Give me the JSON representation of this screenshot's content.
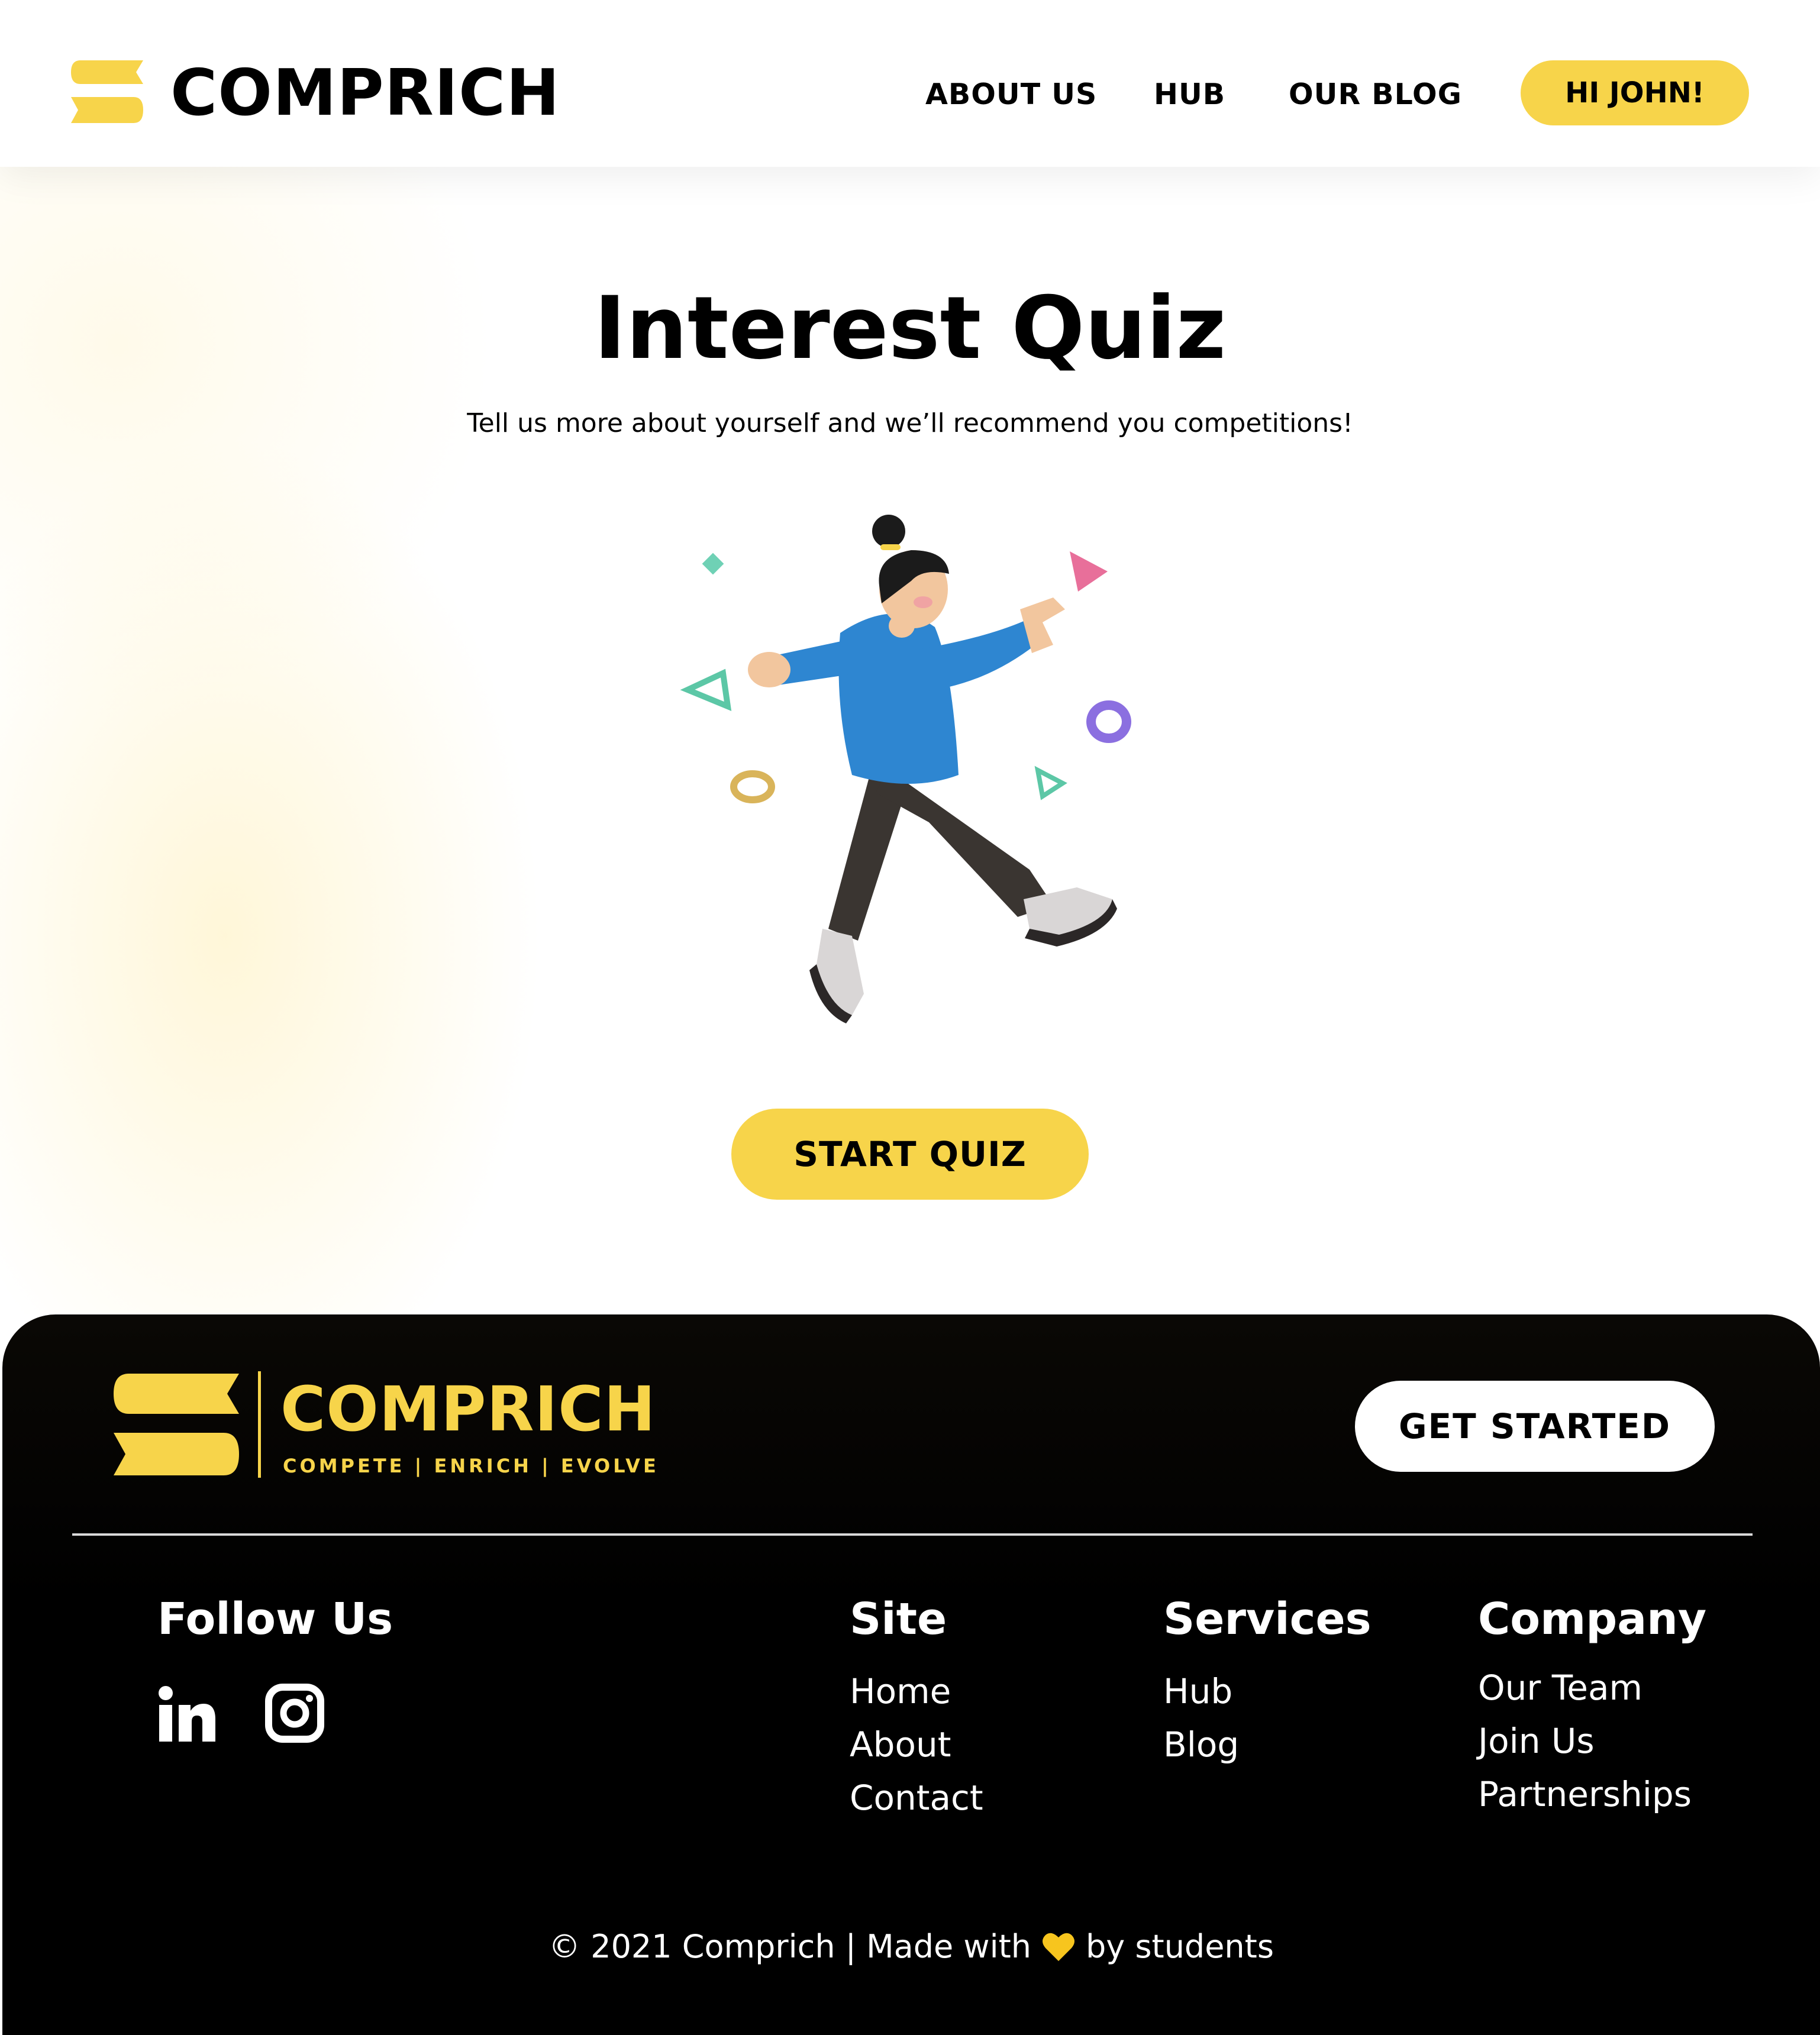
{
  "header": {
    "brand": "COMPRICH",
    "nav": {
      "about": "ABOUT US",
      "hub": "HUB",
      "blog": "OUR BLOG"
    },
    "user_button": "HI JOHN!"
  },
  "main": {
    "title": "Interest Quiz",
    "subtitle": "Tell us more about yourself and we’ll recommend you competitions!",
    "illustration_icon": "running-person-illustration",
    "start_button": "START QUIZ"
  },
  "footer": {
    "brand": "COMPRICH",
    "tagline": "COMPETE | ENRICH | EVOLVE",
    "get_started": "GET STARTED",
    "follow_heading": "Follow Us",
    "social": [
      "linkedin-icon",
      "instagram-icon"
    ],
    "site": {
      "heading": "Site",
      "links": [
        "Home",
        "About",
        "Contact"
      ]
    },
    "services": {
      "heading": "Services",
      "links": [
        "Hub",
        "Blog"
      ]
    },
    "company": {
      "heading": "Company",
      "links": [
        "Our Team",
        "Join Us",
        "Partnerships"
      ]
    },
    "copyright_left": "© 2021 Comprich | Made with",
    "copyright_right": "by students"
  },
  "colors": {
    "accent": "#f7d44a",
    "footer_bg": "#000000",
    "text": "#000000"
  }
}
